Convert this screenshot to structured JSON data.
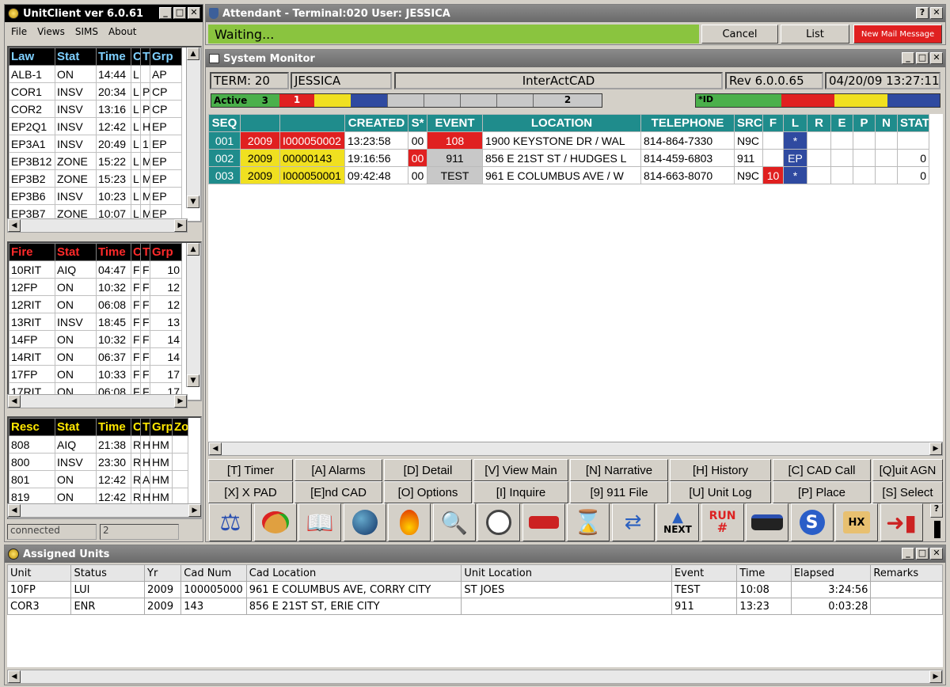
{
  "unitclient": {
    "title": "UnitClient ver 6.0.61",
    "menu": [
      "File",
      "Views",
      "SIMS",
      "About"
    ],
    "status": "connected",
    "status_count": "2",
    "law": {
      "headers": [
        "Law",
        "Stat",
        "Time",
        "C",
        "T",
        "Grp"
      ],
      "rows": [
        [
          "ALB-1",
          "ON",
          "14:44",
          "L",
          "",
          "AP"
        ],
        [
          "COR1",
          "INSV",
          "20:34",
          "L",
          "P",
          "CP"
        ],
        [
          "COR2",
          "INSV",
          "13:16",
          "L",
          "P",
          "CP"
        ],
        [
          "EP2Q1",
          "INSV",
          "12:42",
          "L",
          "H",
          "EP"
        ],
        [
          "EP3A1",
          "INSV",
          "20:49",
          "L",
          "1",
          "EP"
        ],
        [
          "EP3B12",
          "ZONE",
          "15:22",
          "L",
          "M",
          "EP"
        ],
        [
          "EP3B2",
          "ZONE",
          "15:23",
          "L",
          "M",
          "EP"
        ],
        [
          "EP3B6",
          "INSV",
          "10:23",
          "L",
          "M",
          "EP"
        ],
        [
          "EP3B7",
          "ZONE",
          "10:07",
          "L",
          "M",
          "EP"
        ]
      ]
    },
    "fire": {
      "headers": [
        "Fire",
        "Stat",
        "Time",
        "C",
        "T",
        "Grp"
      ],
      "rows": [
        [
          "10RIT",
          "AIQ",
          "04:47",
          "F",
          "F",
          "10"
        ],
        [
          "12FP",
          "ON",
          "10:32",
          "F",
          "F",
          "12"
        ],
        [
          "12RIT",
          "ON",
          "06:08",
          "F",
          "F",
          "12"
        ],
        [
          "13RIT",
          "INSV",
          "18:45",
          "F",
          "F",
          "13"
        ],
        [
          "14FP",
          "ON",
          "10:32",
          "F",
          "F",
          "14"
        ],
        [
          "14RIT",
          "ON",
          "06:37",
          "F",
          "F",
          "14"
        ],
        [
          "17FP",
          "ON",
          "10:33",
          "F",
          "F",
          "17"
        ],
        [
          "17RIT",
          "ON",
          "06:08",
          "F",
          "F",
          "17"
        ]
      ]
    },
    "resc": {
      "headers": [
        "Resc",
        "Stat",
        "Time",
        "C",
        "T",
        "Grp",
        "Zo"
      ],
      "rows": [
        [
          "808",
          "AIQ",
          "21:38",
          "R",
          "H",
          "HM",
          ""
        ],
        [
          "800",
          "INSV",
          "23:30",
          "R",
          "H",
          "HM",
          ""
        ],
        [
          "801",
          "ON",
          "12:42",
          "R",
          "A",
          "HM",
          ""
        ],
        [
          "819",
          "ON",
          "12:42",
          "R",
          "H",
          "HM",
          ""
        ]
      ]
    }
  },
  "attendant": {
    "title": "Attendant - Terminal:020 User: JESSICA",
    "status": "Waiting...",
    "cancel": "Cancel",
    "list": "List",
    "mail": "New Mail Message"
  },
  "monitor": {
    "title": "System Monitor",
    "term": "TERM: 20",
    "user": "JESSICA",
    "app": "InterActCAD",
    "rev": "Rev 6.0.0.65",
    "datetime": "04/20/09 13:27:11",
    "active_label": "Active",
    "active_count": "3",
    "red_count": "1",
    "gray_count": "2",
    "id_label": "*ID",
    "headers": [
      "SEQ",
      "",
      "",
      "CREATED",
      "S*",
      "EVENT",
      "LOCATION",
      "TELEPHONE",
      "SRC",
      "F",
      "L",
      "R",
      "E",
      "P",
      "N",
      "STAT"
    ],
    "rows": [
      [
        "001",
        "2009",
        "I000050002",
        "13:23:58",
        "00",
        "108",
        "1900 KEYSTONE DR / WAL",
        "814-864-7330",
        "N9C",
        "",
        "*",
        "",
        "",
        "",
        "",
        ""
      ],
      [
        "002",
        "2009",
        "00000143",
        "19:16:56",
        "00",
        "911",
        "856 E 21ST ST / HUDGES L",
        "814-459-6803",
        "911",
        "",
        "EP",
        "",
        "",
        "",
        "",
        "0"
      ],
      [
        "003",
        "2009",
        "I000050001",
        "09:42:48",
        "00",
        "TEST",
        "961 E COLUMBUS AVE / W",
        "814-663-8070",
        "N9C",
        "10",
        "*",
        "",
        "",
        "",
        "",
        "0"
      ]
    ],
    "commands": [
      [
        "[T] Timer",
        "[A] Alarms",
        "[D] Detail",
        "[V] View Main",
        "[N] Narrative",
        "[H] History",
        "[C] CAD Call",
        "[Q]uit AGN"
      ],
      [
        "[X] X PAD",
        "[E]nd CAD",
        "[O] Options",
        "[I] Inquire",
        "[9] 911 File",
        "[U] Unit Log",
        "[P] Place",
        "[S] Select"
      ]
    ],
    "icons": [
      "scales-icon",
      "palette-icon",
      "book-icon",
      "globe-icon",
      "fire-icon",
      "magnifier-icon",
      "clock-icon",
      "tow-truck-icon",
      "hourglass-icon",
      "transfer-icon",
      "next-icon",
      "run-number-icon",
      "police-car-icon",
      "s-badge-icon",
      "hx-scroll-icon",
      "exit-door-icon"
    ],
    "next_label": "NEXT",
    "run_label": "RUN",
    "run_hash": "#",
    "hx_label": "HX",
    "help": "?"
  },
  "assigned": {
    "title": "Assigned Units",
    "headers": [
      "Unit",
      "Status",
      "Yr",
      "Cad Num",
      "Cad Location",
      "Unit Location",
      "Event",
      "Time",
      "Elapsed",
      "Remarks"
    ],
    "rows": [
      [
        "10FP",
        "LUI",
        "2009",
        "100005000",
        "961 E COLUMBUS AVE, CORRY CITY",
        "ST JOES",
        "TEST",
        "10:08",
        "3:24:56",
        ""
      ],
      [
        "COR3",
        "ENR",
        "2009",
        "143",
        "856 E 21ST ST, ERIE CITY",
        "",
        "911",
        "13:23",
        "0:03:28",
        ""
      ]
    ]
  }
}
